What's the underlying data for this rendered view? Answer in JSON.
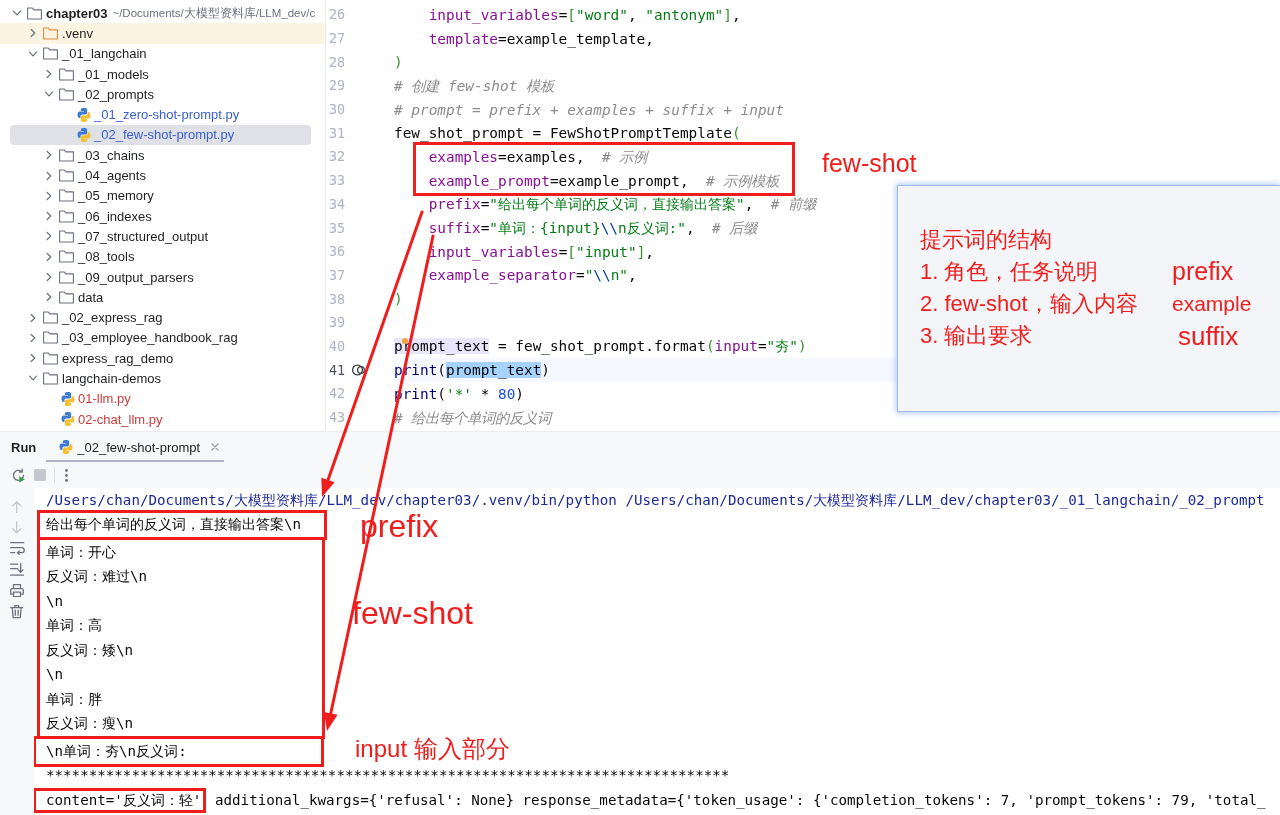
{
  "project_tree": [
    {
      "kind": "folder",
      "name": "chapter03",
      "path": "~/Documents/大模型资料库/LLM_dev/c",
      "expanded": true,
      "selected": false,
      "children": [
        {
          "kind": "excluded_folder",
          "name": ".venv",
          "expanded": false,
          "selected": false
        },
        {
          "kind": "folder",
          "name": "_01_langchain",
          "expanded": true,
          "selected": false,
          "children": [
            {
              "kind": "folder",
              "name": "_01_models",
              "expanded": false,
              "selected": false
            },
            {
              "kind": "folder",
              "name": "_02_prompts",
              "expanded": true,
              "selected": false,
              "children": [
                {
                  "kind": "python_file",
                  "name": "_01_zero-shot-prompt.py",
                  "color": "#3a5fcd",
                  "selected": false
                },
                {
                  "kind": "python_file",
                  "name": "_02_few-shot-prompt.py",
                  "color": "#3a5fcd",
                  "selected": true
                }
              ]
            },
            {
              "kind": "folder",
              "name": "_03_chains",
              "expanded": false,
              "selected": false
            },
            {
              "kind": "folder",
              "name": "_04_agents",
              "expanded": false,
              "selected": false
            },
            {
              "kind": "folder",
              "name": "_05_memory",
              "expanded": false,
              "selected": false
            },
            {
              "kind": "folder",
              "name": "_06_indexes",
              "expanded": false,
              "selected": false
            },
            {
              "kind": "folder",
              "name": "_07_structured_output",
              "expanded": false,
              "selected": false
            },
            {
              "kind": "folder",
              "name": "_08_tools",
              "expanded": false,
              "selected": false
            },
            {
              "kind": "folder",
              "name": "_09_output_parsers",
              "expanded": false,
              "selected": false
            },
            {
              "kind": "folder",
              "name": "data",
              "expanded": false,
              "selected": false
            }
          ]
        },
        {
          "kind": "folder",
          "name": "_02_express_rag",
          "expanded": false,
          "selected": false
        },
        {
          "kind": "folder",
          "name": "_03_employee_handbook_rag",
          "expanded": false,
          "selected": false
        },
        {
          "kind": "folder",
          "name": "express_rag_demo",
          "expanded": false,
          "selected": false
        },
        {
          "kind": "folder",
          "name": "langchain-demos",
          "expanded": true,
          "selected": false,
          "children": [
            {
              "kind": "python_file",
              "name": "01-llm.py",
              "color": "#c93b3b",
              "selected": false
            },
            {
              "kind": "python_file",
              "name": "02-chat_llm.py",
              "color": "#c93b3b",
              "selected": false
            }
          ]
        }
      ]
    }
  ],
  "editor": {
    "lines": [
      {
        "number": "26",
        "current": false,
        "run_marker": false,
        "intention_marker": false,
        "tokens": [
          {
            "kind": "kwarg",
            "text": "    input_variables"
          },
          {
            "kind": "plain",
            "text": "="
          },
          {
            "kind": "bracket",
            "text": "["
          },
          {
            "kind": "string",
            "text": "\"word\""
          },
          {
            "kind": "plain",
            "text": ", "
          },
          {
            "kind": "string",
            "text": "\"antonym\""
          },
          {
            "kind": "bracket",
            "text": "]"
          },
          {
            "kind": "plain",
            "text": ","
          }
        ]
      },
      {
        "number": "27",
        "current": false,
        "run_marker": false,
        "intention_marker": false,
        "tokens": [
          {
            "kind": "kwarg",
            "text": "    template"
          },
          {
            "kind": "plain",
            "text": "=example_template,"
          }
        ]
      },
      {
        "number": "28",
        "current": false,
        "run_marker": false,
        "intention_marker": false,
        "tokens": [
          {
            "kind": "bracket",
            "text": ")"
          }
        ]
      },
      {
        "number": "29",
        "current": false,
        "run_marker": false,
        "intention_marker": false,
        "tokens": [
          {
            "kind": "comment",
            "text": "# 创建 few-shot 模板"
          }
        ]
      },
      {
        "number": "30",
        "current": false,
        "run_marker": false,
        "intention_marker": false,
        "tokens": [
          {
            "kind": "comment",
            "text": "# prompt = prefix + examples + suffix + input"
          }
        ]
      },
      {
        "number": "31",
        "current": false,
        "run_marker": false,
        "intention_marker": false,
        "tokens": [
          {
            "kind": "plain",
            "text": "few_shot_prompt = FewShotPromptTemplate"
          },
          {
            "kind": "bracket",
            "text": "("
          }
        ]
      },
      {
        "number": "32",
        "current": false,
        "run_marker": false,
        "intention_marker": false,
        "tokens": [
          {
            "kind": "kwarg",
            "text": "    examples"
          },
          {
            "kind": "plain",
            "text": "=examples,  "
          },
          {
            "kind": "comment",
            "text": "# 示例"
          }
        ]
      },
      {
        "number": "33",
        "current": false,
        "run_marker": false,
        "intention_marker": false,
        "tokens": [
          {
            "kind": "kwarg",
            "text": "    example_prompt"
          },
          {
            "kind": "plain",
            "text": "=example_prompt,  "
          },
          {
            "kind": "comment",
            "text": "# 示例模板"
          }
        ]
      },
      {
        "number": "34",
        "current": false,
        "run_marker": false,
        "intention_marker": false,
        "tokens": [
          {
            "kind": "kwarg",
            "text": "    prefix"
          },
          {
            "kind": "plain",
            "text": "="
          },
          {
            "kind": "string",
            "text": "\"给出每个单词的反义词，直接输出答案\""
          },
          {
            "kind": "plain",
            "text": ",  "
          },
          {
            "kind": "comment",
            "text": "# 前缀"
          }
        ]
      },
      {
        "number": "35",
        "current": false,
        "run_marker": false,
        "intention_marker": false,
        "tokens": [
          {
            "kind": "kwarg",
            "text": "    suffix"
          },
          {
            "kind": "plain",
            "text": "="
          },
          {
            "kind": "string",
            "text": "\"单词：{input}"
          },
          {
            "kind": "escape",
            "text": "\\\\"
          },
          {
            "kind": "string",
            "text": "n反义词:\""
          },
          {
            "kind": "plain",
            "text": ",  "
          },
          {
            "kind": "comment",
            "text": "# 后缀"
          }
        ]
      },
      {
        "number": "36",
        "current": false,
        "run_marker": false,
        "intention_marker": false,
        "tokens": [
          {
            "kind": "kwarg",
            "text": "    input_variables"
          },
          {
            "kind": "plain",
            "text": "="
          },
          {
            "kind": "bracket",
            "text": "["
          },
          {
            "kind": "string",
            "text": "\"input\""
          },
          {
            "kind": "bracket",
            "text": "]"
          },
          {
            "kind": "plain",
            "text": ","
          }
        ]
      },
      {
        "number": "37",
        "current": false,
        "run_marker": false,
        "intention_marker": false,
        "tokens": [
          {
            "kind": "kwarg",
            "text": "    example_separator"
          },
          {
            "kind": "plain",
            "text": "="
          },
          {
            "kind": "string",
            "text": "\""
          },
          {
            "kind": "escape",
            "text": "\\\\"
          },
          {
            "kind": "string",
            "text": "n\""
          },
          {
            "kind": "plain",
            "text": ","
          }
        ]
      },
      {
        "number": "38",
        "current": false,
        "run_marker": false,
        "intention_marker": false,
        "tokens": [
          {
            "kind": "bracket",
            "text": ")"
          }
        ]
      },
      {
        "number": "39",
        "current": false,
        "run_marker": false,
        "intention_marker": false
      },
      {
        "number": "40",
        "current": false,
        "run_marker": false,
        "intention_marker": true,
        "tokens": [
          {
            "kind": "usage",
            "text": "prompt_text"
          },
          {
            "kind": "plain",
            "text": " = few_shot_prompt.format"
          },
          {
            "kind": "bracket",
            "text": "("
          },
          {
            "kind": "kwarg",
            "text": "input"
          },
          {
            "kind": "plain",
            "text": "="
          },
          {
            "kind": "string",
            "text": "\"夯\""
          },
          {
            "kind": "bracket",
            "text": ")"
          }
        ]
      },
      {
        "number": "41",
        "current": true,
        "run_marker": true,
        "intention_marker": false,
        "tokens": [
          {
            "kind": "builtin",
            "text": "print"
          },
          {
            "kind": "plain",
            "text": "("
          },
          {
            "kind": "selection",
            "text": "prompt_text"
          },
          {
            "kind": "plain",
            "text": ")"
          }
        ]
      },
      {
        "number": "42",
        "current": false,
        "run_marker": false,
        "intention_marker": false,
        "tokens": [
          {
            "kind": "builtin",
            "text": "print"
          },
          {
            "kind": "plain",
            "text": "("
          },
          {
            "kind": "string",
            "text": "'*'"
          },
          {
            "kind": "plain",
            "text": " * "
          },
          {
            "kind": "number",
            "text": "80"
          },
          {
            "kind": "plain",
            "text": ")"
          }
        ]
      },
      {
        "number": "43",
        "current": false,
        "run_marker": false,
        "intention_marker": false,
        "tokens": [
          {
            "kind": "comment",
            "text": "# 给出每个单词的反义词"
          }
        ]
      }
    ]
  },
  "run_panel": {
    "title": "Run",
    "tabs": [
      {
        "label": "_02_few-shot-prompt",
        "selected": true
      }
    ],
    "toolbar": [
      {
        "kind": "rerun",
        "disabled": false
      },
      {
        "kind": "stop",
        "disabled": true
      },
      {
        "kind": "more",
        "disabled": false
      }
    ],
    "side_tools": [
      {
        "kind": "scroll_up",
        "disabled": true
      },
      {
        "kind": "scroll_down",
        "disabled": true
      },
      {
        "kind": "soft_wrap",
        "disabled": false
      },
      {
        "kind": "scroll_to_end",
        "disabled": false
      },
      {
        "kind": "print",
        "disabled": false
      },
      {
        "kind": "clear",
        "disabled": false
      }
    ],
    "output": [
      {
        "kind": "command",
        "text": "/Users/chan/Documents/大模型资料库/LLM_dev/chapter03/.venv/bin/python /Users/chan/Documents/大模型资料库/LLM_dev/chapter03/_01_langchain/_02_prompt"
      },
      {
        "kind": "stdout",
        "text": "给出每个单词的反义词，直接输出答案\\n"
      },
      {
        "kind": "stdout",
        "text": "单词：开心"
      },
      {
        "kind": "stdout",
        "text": "反义词：难过\\n"
      },
      {
        "kind": "stdout",
        "text": "\\n"
      },
      {
        "kind": "stdout",
        "text": "单词：高"
      },
      {
        "kind": "stdout",
        "text": "反义词：矮\\n"
      },
      {
        "kind": "stdout",
        "text": "\\n"
      },
      {
        "kind": "stdout",
        "text": "单词：胖"
      },
      {
        "kind": "stdout",
        "text": "反义词：瘦\\n"
      },
      {
        "kind": "stdout",
        "text": "\\n单词：夯\\n反义词:"
      },
      {
        "kind": "stdout",
        "text": "********************************************************************************"
      },
      {
        "kind": "stdout",
        "segments": [
          "content='反义词：轻'",
          " additional_kwargs={'refusal': None} response_metadata={'token_usage': {'completion_tokens': 7, 'prompt_tokens': 79, 'total_"
        ]
      }
    ]
  },
  "annotations": {
    "labels": [
      "few-shot",
      "prefix",
      "few-shot",
      "input 输入部分"
    ],
    "note": {
      "title": "提示词的结构",
      "items": [
        {
          "text": "1. 角色，任务说明",
          "tag": "prefix"
        },
        {
          "text": "2. few-shot，输入内容",
          "tag": "example"
        },
        {
          "text": "3. 输出要求",
          "tag": "suffix"
        }
      ]
    }
  }
}
